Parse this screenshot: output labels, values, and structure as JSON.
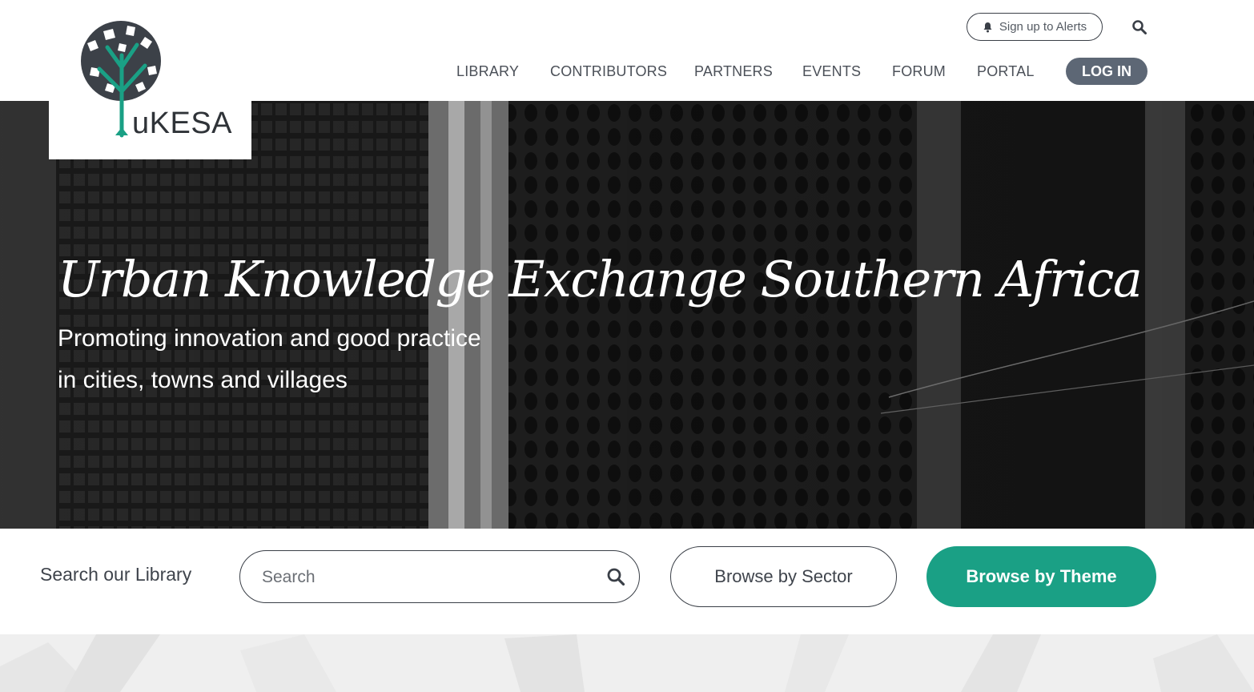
{
  "header": {
    "alerts_label": "Sign up to Alerts",
    "nav": [
      {
        "label": "LIBRARY"
      },
      {
        "label": "CONTRIBUTORS"
      },
      {
        "label": "PARTNERS"
      },
      {
        "label": "EVENTS"
      },
      {
        "label": "FORUM"
      },
      {
        "label": "PORTAL"
      }
    ],
    "login_label": "LOG IN"
  },
  "logo": {
    "text": "uKESA",
    "icon": "tree-logo-icon",
    "accent_color": "#1aa085"
  },
  "hero": {
    "title": "Urban Knowledge Exchange Southern Africa",
    "subtitle_line1": "Promoting innovation and good practice",
    "subtitle_line2": "in cities, towns and villages"
  },
  "library_search": {
    "label": "Search our Library",
    "placeholder": "Search",
    "value": "",
    "browse_sector_label": "Browse by Sector",
    "browse_theme_label": "Browse by Theme"
  },
  "colors": {
    "login_bg": "#5d6775",
    "theme_button_bg": "#1aa085",
    "text": "#4b5058"
  }
}
